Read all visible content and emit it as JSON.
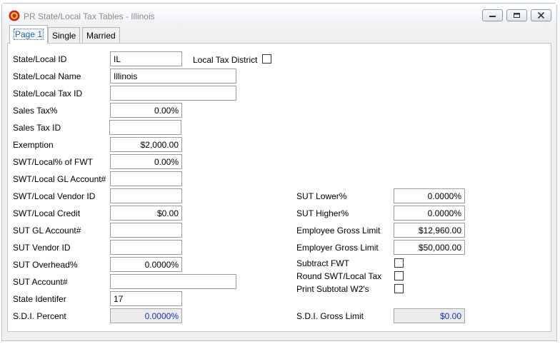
{
  "window": {
    "title": "PR State/Local Tax Tables - Illinois"
  },
  "tabs": [
    {
      "label": "Page 1",
      "active": true
    },
    {
      "label": "Single",
      "active": false
    },
    {
      "label": "Married",
      "active": false
    }
  ],
  "left": {
    "state_local_id": {
      "label": "State/Local ID",
      "value": "IL"
    },
    "local_tax_district": {
      "label": "Local Tax District",
      "checked": false
    },
    "state_local_name": {
      "label": "State/Local Name",
      "value": "Illinois"
    },
    "state_local_tax_id": {
      "label": "State/Local Tax ID",
      "value": ""
    },
    "sales_tax_pct": {
      "label": "Sales Tax%",
      "value": "0.00%"
    },
    "sales_tax_id": {
      "label": "Sales Tax ID",
      "value": ""
    },
    "exemption": {
      "label": "Exemption",
      "value": "$2,000.00"
    },
    "swt_local_pct_fwt": {
      "label": "SWT/Local% of FWT",
      "value": "0.00%"
    },
    "swt_local_gl_account": {
      "label": "SWT/Local GL Account#",
      "value": ""
    },
    "swt_local_vendor_id": {
      "label": "SWT/Local Vendor ID",
      "value": ""
    },
    "swt_local_credit": {
      "label": "SWT/Local Credit",
      "value": "$0.00"
    },
    "sut_gl_account": {
      "label": "SUT GL Account#",
      "value": ""
    },
    "sut_vendor_id": {
      "label": "SUT Vendor ID",
      "value": ""
    },
    "sut_overhead_pct": {
      "label": "SUT Overhead%",
      "value": "0.0000%"
    },
    "sut_account": {
      "label": "SUT Account#",
      "value": ""
    },
    "state_identifier": {
      "label": "State Identifer",
      "value": "17"
    },
    "sdi_percent": {
      "label": "S.D.I. Percent",
      "value": "0.0000%"
    }
  },
  "right": {
    "sut_lower_pct": {
      "label": "SUT Lower%",
      "value": "0.0000%"
    },
    "sut_higher_pct": {
      "label": "SUT Higher%",
      "value": "0.0000%"
    },
    "employee_gross_limit": {
      "label": "Employee Gross Limit",
      "value": "$12,960.00"
    },
    "employer_gross_limit": {
      "label": "Employer Gross Limit",
      "value": "$50,000.00"
    },
    "subtract_fwt": {
      "label": "Subtract FWT",
      "checked": false
    },
    "round_swt_local_tax": {
      "label": "Round SWT/Local Tax",
      "checked": false
    },
    "print_subtotal_w2s": {
      "label": "Print Subtotal W2's",
      "checked": false
    },
    "sdi_gross_limit": {
      "label": "S.D.I. Gross Limit",
      "value": "$0.00"
    }
  },
  "colors": {
    "readonly_text": "#1c2fb8",
    "active_tab_text": "#1a5fc6"
  },
  "icons": {
    "app": "shield-icon",
    "minimize": "minimize-icon",
    "maximize": "maximize-icon",
    "close": "close-icon"
  }
}
